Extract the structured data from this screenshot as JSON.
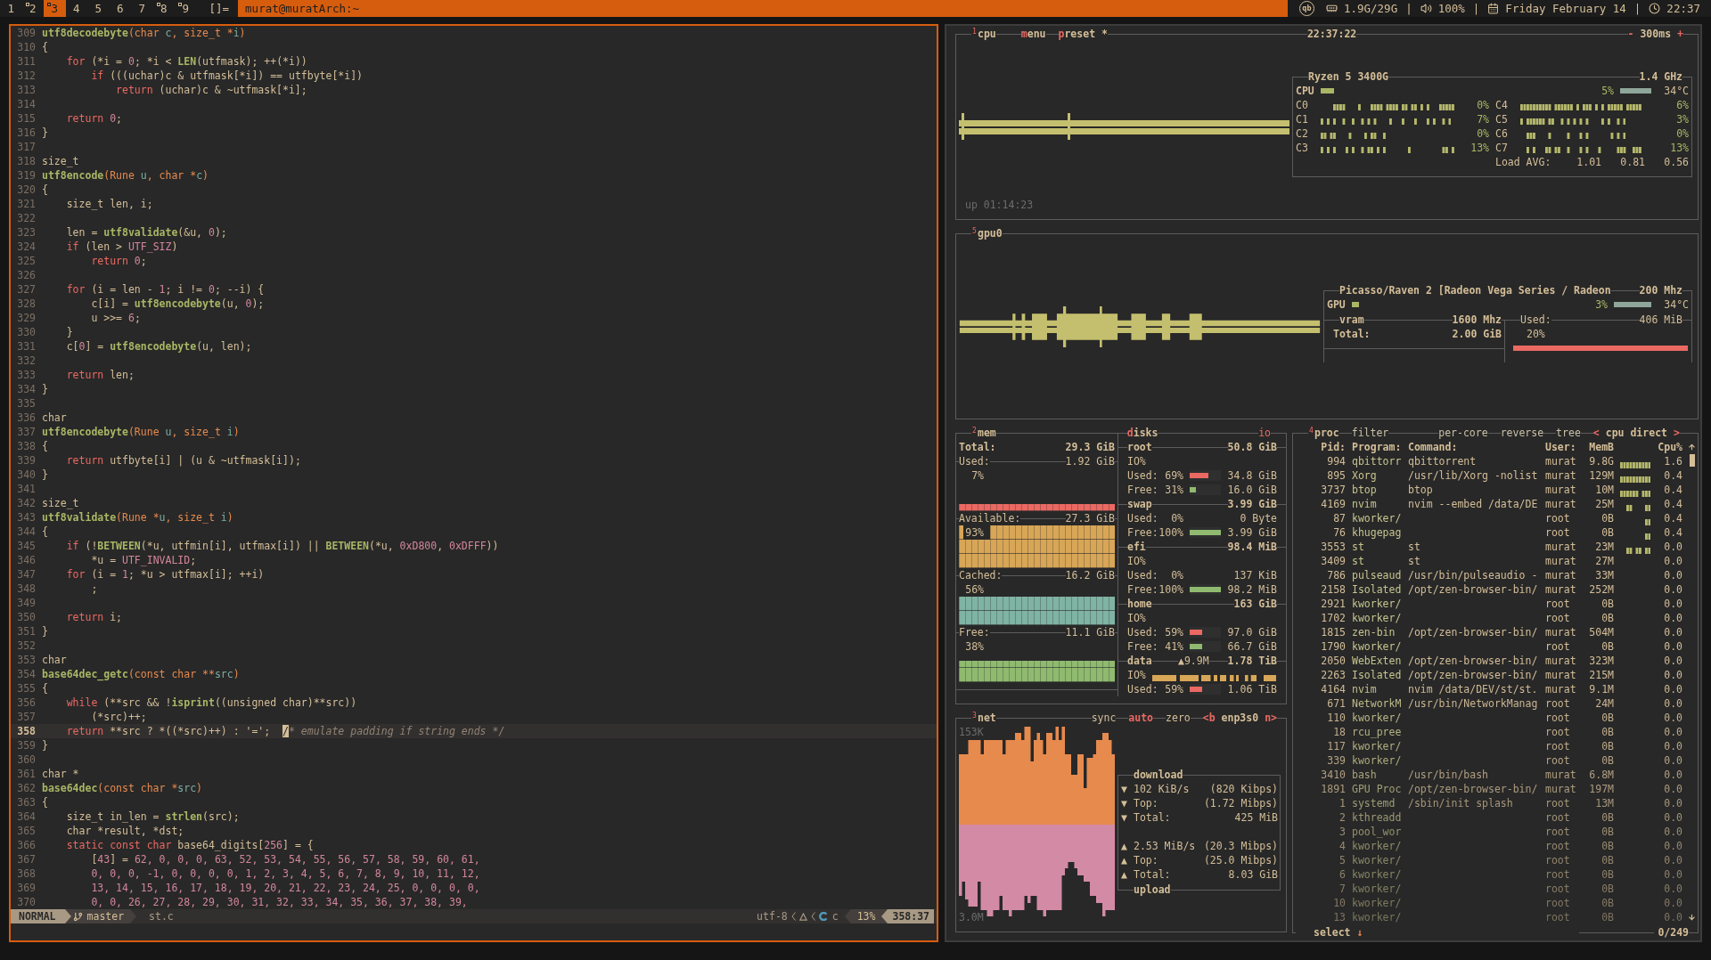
{
  "top_bar": {
    "tags": [
      {
        "label": "1",
        "occupied": false,
        "selected": false
      },
      {
        "label": "2",
        "occupied": true,
        "selected": false
      },
      {
        "label": "3",
        "occupied": true,
        "selected": true
      },
      {
        "label": "4",
        "occupied": false,
        "selected": false
      },
      {
        "label": "5",
        "occupied": false,
        "selected": false
      },
      {
        "label": "6",
        "occupied": false,
        "selected": false
      },
      {
        "label": "7",
        "occupied": false,
        "selected": false
      },
      {
        "label": "8",
        "occupied": true,
        "selected": false
      },
      {
        "label": "9",
        "occupied": true,
        "selected": false
      }
    ],
    "layout_symbol": "[]=",
    "window_title": "murat@muratArch:~",
    "tray_logo": "qb",
    "status": [
      {
        "kind": "memory",
        "text": "1.9G/29G"
      },
      {
        "kind": "volume",
        "separator": "|",
        "text": "100%"
      },
      {
        "kind": "date",
        "separator": "|",
        "text": "Friday February 14"
      },
      {
        "kind": "time",
        "separator": "|",
        "text": "22:37"
      }
    ]
  },
  "editor": {
    "lines": [
      {
        "number": "309",
        "current": false,
        "code": [
          {
            "text": "utf8decodebyte",
            "kind": "fn"
          },
          {
            "text": "(char ",
            "kind": "type"
          },
          {
            "text": "c",
            "kind": "param"
          },
          {
            "text": ", size_t *",
            "kind": "type"
          },
          {
            "text": "i",
            "kind": "param"
          },
          {
            "text": ")",
            "kind": "type"
          }
        ]
      },
      {
        "number": "310",
        "current": false,
        "code": [
          "{"
        ]
      },
      {
        "number": "311",
        "current": false,
        "code": [
          {
            "text": "    for",
            "kind": "kw"
          },
          " (*i = ",
          {
            "text": "0",
            "kind": "num"
          },
          "; *i < ",
          {
            "text": "LEN",
            "kind": "fn"
          },
          "(utfmask); ++(*i))"
        ]
      },
      {
        "number": "312",
        "current": false,
        "code": [
          {
            "text": "        if",
            "kind": "kw"
          },
          " (((uchar)c & utfmask[*i]) == utfbyte[*i])"
        ]
      },
      {
        "number": "313",
        "current": false,
        "code": [
          {
            "text": "            return",
            "kind": "kw"
          },
          " (uchar)c & ~utfmask[*i];"
        ]
      },
      {
        "number": "314",
        "current": false
      },
      {
        "number": "315",
        "current": false,
        "code": [
          {
            "text": "    return",
            "kind": "kw"
          },
          {
            "text": " 0",
            "kind": "num"
          },
          ";"
        ]
      },
      {
        "number": "316",
        "current": false,
        "code": [
          "}"
        ]
      },
      {
        "number": "317",
        "current": false
      },
      {
        "number": "318",
        "current": false,
        "code": [
          "size_t"
        ]
      },
      {
        "number": "319",
        "current": false,
        "code": [
          {
            "text": "utf8encode",
            "kind": "fn"
          },
          {
            "text": "(Rune ",
            "kind": "type"
          },
          {
            "text": "u",
            "kind": "param"
          },
          {
            "text": ", char *",
            "kind": "type"
          },
          {
            "text": "c",
            "kind": "param"
          },
          {
            "text": ")",
            "kind": "type"
          }
        ]
      },
      {
        "number": "320",
        "current": false,
        "code": [
          "{"
        ]
      },
      {
        "number": "321",
        "current": false,
        "code": [
          "    size_t len, i;"
        ]
      },
      {
        "number": "322",
        "current": false
      },
      {
        "number": "323",
        "current": false,
        "code": [
          "    len = ",
          {
            "text": "utf8validate",
            "kind": "fn"
          },
          "(&u, ",
          {
            "text": "0",
            "kind": "num"
          },
          ");"
        ]
      },
      {
        "number": "324",
        "current": false,
        "code": [
          {
            "text": "    if",
            "kind": "kw"
          },
          " (len > ",
          {
            "text": "UTF_SIZ",
            "kind": "num"
          },
          ")"
        ]
      },
      {
        "number": "325",
        "current": false,
        "code": [
          {
            "text": "        return",
            "kind": "kw"
          },
          {
            "text": " 0",
            "kind": "num"
          },
          ";"
        ]
      },
      {
        "number": "326",
        "current": false
      },
      {
        "number": "327",
        "current": false,
        "code": [
          {
            "text": "    for",
            "kind": "kw"
          },
          " (i = len - ",
          {
            "text": "1",
            "kind": "num"
          },
          "; i != ",
          {
            "text": "0",
            "kind": "num"
          },
          "; --i) {"
        ]
      },
      {
        "number": "328",
        "current": false,
        "code": [
          "        c[i] = ",
          {
            "text": "utf8encodebyte",
            "kind": "fn"
          },
          "(u, ",
          {
            "text": "0",
            "kind": "num"
          },
          ");"
        ]
      },
      {
        "number": "329",
        "current": false,
        "code": [
          "        u >>= ",
          {
            "text": "6",
            "kind": "num"
          },
          ";"
        ]
      },
      {
        "number": "330",
        "current": false,
        "code": [
          "    }"
        ]
      },
      {
        "number": "331",
        "current": false,
        "code": [
          "    c[",
          {
            "text": "0",
            "kind": "num"
          },
          "] = ",
          {
            "text": "utf8encodebyte",
            "kind": "fn"
          },
          "(u, len);"
        ]
      },
      {
        "number": "332",
        "current": false
      },
      {
        "number": "333",
        "current": false,
        "code": [
          {
            "text": "    return",
            "kind": "kw"
          },
          " len;"
        ]
      },
      {
        "number": "334",
        "current": false,
        "code": [
          "}"
        ]
      },
      {
        "number": "335",
        "current": false
      },
      {
        "number": "336",
        "current": false,
        "code": [
          "char"
        ]
      },
      {
        "number": "337",
        "current": false,
        "code": [
          {
            "text": "utf8encodebyte",
            "kind": "fn"
          },
          {
            "text": "(Rune ",
            "kind": "type"
          },
          {
            "text": "u",
            "kind": "param"
          },
          {
            "text": ", size_t ",
            "kind": "type"
          },
          {
            "text": "i",
            "kind": "param"
          },
          {
            "text": ")",
            "kind": "type"
          }
        ]
      },
      {
        "number": "338",
        "current": false,
        "code": [
          "{"
        ]
      },
      {
        "number": "339",
        "current": false,
        "code": [
          {
            "text": "    return",
            "kind": "kw"
          },
          " utfbyte[i] | (u & ~utfmask[i]);"
        ]
      },
      {
        "number": "340",
        "current": false,
        "code": [
          "}"
        ]
      },
      {
        "number": "341",
        "current": false
      },
      {
        "number": "342",
        "current": false,
        "code": [
          "size_t"
        ]
      },
      {
        "number": "343",
        "current": false,
        "code": [
          {
            "text": "utf8validate",
            "kind": "fn"
          },
          {
            "text": "(Rune *",
            "kind": "type"
          },
          {
            "text": "u",
            "kind": "param"
          },
          {
            "text": ", size_t ",
            "kind": "type"
          },
          {
            "text": "i",
            "kind": "param"
          },
          {
            "text": ")",
            "kind": "type"
          }
        ]
      },
      {
        "number": "344",
        "current": false,
        "code": [
          "{"
        ]
      },
      {
        "number": "345",
        "current": false,
        "code": [
          {
            "text": "    if",
            "kind": "kw"
          },
          " (!",
          {
            "text": "BETWEEN",
            "kind": "fn"
          },
          "(*u, utfmin[i], utfmax[i]) || ",
          {
            "text": "BETWEEN",
            "kind": "fn"
          },
          "(*u, ",
          {
            "text": "0xD800",
            "kind": "num"
          },
          ", ",
          {
            "text": "0xDFFF",
            "kind": "num"
          },
          "))"
        ]
      },
      {
        "number": "346",
        "current": false,
        "code": [
          "        *u = ",
          {
            "text": "UTF_INVALID",
            "kind": "num"
          },
          ";"
        ]
      },
      {
        "number": "347",
        "current": false,
        "code": [
          {
            "text": "    for",
            "kind": "kw"
          },
          " (i = ",
          {
            "text": "1",
            "kind": "num"
          },
          "; *u > utfmax[i]; ++i)"
        ]
      },
      {
        "number": "348",
        "current": false,
        "code": [
          "        ;"
        ]
      },
      {
        "number": "349",
        "current": false
      },
      {
        "number": "350",
        "current": false,
        "code": [
          {
            "text": "    return",
            "kind": "kw"
          },
          " i;"
        ]
      },
      {
        "number": "351",
        "current": false,
        "code": [
          "}"
        ]
      },
      {
        "number": "352",
        "current": false
      },
      {
        "number": "353",
        "current": false,
        "code": [
          "char"
        ]
      },
      {
        "number": "354",
        "current": false,
        "code": [
          {
            "text": "base64dec_getc",
            "kind": "fn"
          },
          {
            "text": "(const char **",
            "kind": "type"
          },
          {
            "text": "src",
            "kind": "param"
          },
          {
            "text": ")",
            "kind": "type"
          }
        ]
      },
      {
        "number": "355",
        "current": false,
        "code": [
          "{"
        ]
      },
      {
        "number": "356",
        "current": false,
        "code": [
          {
            "text": "    while",
            "kind": "kw"
          },
          " (**src && !",
          {
            "text": "isprint",
            "kind": "fn"
          },
          "((unsigned char)**src))"
        ]
      },
      {
        "number": "357",
        "current": false,
        "code": [
          "        (*src)++;"
        ]
      },
      {
        "number": "358",
        "current": true,
        "code": [
          {
            "text": "    return",
            "kind": "kw"
          },
          " **src ? *((*src)++) : '=';  ",
          {
            "text": "/* emulate padding if string ends */",
            "kind": "comment",
            "cursor": true
          }
        ]
      },
      {
        "number": "359",
        "current": false,
        "code": [
          "}"
        ]
      },
      {
        "number": "360",
        "current": false
      },
      {
        "number": "361",
        "current": false,
        "code": [
          "char *"
        ]
      },
      {
        "number": "362",
        "current": false,
        "code": [
          {
            "text": "base64dec",
            "kind": "fn"
          },
          {
            "text": "(const char *",
            "kind": "type"
          },
          {
            "text": "src",
            "kind": "param"
          },
          {
            "text": ")",
            "kind": "type"
          }
        ]
      },
      {
        "number": "363",
        "current": false,
        "code": [
          "{"
        ]
      },
      {
        "number": "364",
        "current": false,
        "code": [
          "    size_t in_len = ",
          {
            "text": "strlen",
            "kind": "fn"
          },
          "(src);"
        ]
      },
      {
        "number": "365",
        "current": false,
        "code": [
          "    char *result, *dst;"
        ]
      },
      {
        "number": "366",
        "current": false,
        "code": [
          {
            "text": "    static const char",
            "kind": "kw"
          },
          " base64_digits[",
          {
            "text": "256",
            "kind": "num"
          },
          "] = {"
        ]
      },
      {
        "number": "367",
        "current": false,
        "code": [
          "        [",
          {
            "text": "43",
            "kind": "num"
          },
          "] = ",
          {
            "text": "62, 0, 0, 0, 63, 52, 53, 54, 55, 56, 57, 58, 59, 60, 61,",
            "kind": "num"
          }
        ]
      },
      {
        "number": "368",
        "current": false,
        "code": [
          {
            "text": "        0, 0, 0, -1, 0, 0, 0, 0, 1, 2, 3, 4, 5, 6, 7, 8, 9, 10, 11, 12,",
            "kind": "num"
          }
        ]
      },
      {
        "number": "369",
        "current": false,
        "code": [
          {
            "text": "        13, 14, 15, 16, 17, 18, 19, 20, 21, 22, 23, 24, 25, 0, 0, 0, 0,",
            "kind": "num"
          }
        ]
      },
      {
        "number": "370",
        "current": false,
        "code": [
          {
            "text": "        0, 0, 26, 27, 28, 29, 30, 31, 32, 33, 34, 35, 36, 37, 38, 39,",
            "kind": "num"
          }
        ]
      }
    ],
    "statusline": {
      "mode": "NORMAL",
      "branch": "master",
      "file": "st.c",
      "encoding": "utf-8",
      "filetype": "c",
      "progress": "13%",
      "position": "358:37"
    }
  },
  "monitor": {
    "cpu": {
      "hotkey": "1",
      "title": "cpu",
      "menu": "menu",
      "preset": "preset *",
      "clock": "22:37:22",
      "interval": {
        "decrease": "-",
        "value": "300ms",
        "increase": "+"
      },
      "uptime": "up 01:14:23",
      "model": "Ryzen 5 3400G",
      "frequency": "1.4 GHz",
      "total": {
        "label": "CPU",
        "level": 0.05,
        "percent": "5%",
        "temperature": "34°C"
      },
      "cores": [
        {
          "label": "C0",
          "percent": "0%"
        },
        {
          "label": "C1",
          "percent": "7%"
        },
        {
          "label": "C2",
          "percent": "0%"
        },
        {
          "label": "C3",
          "percent": "13%"
        },
        {
          "label": "C4",
          "percent": "6%"
        },
        {
          "label": "C5",
          "percent": "3%"
        },
        {
          "label": "C6",
          "percent": "0%"
        },
        {
          "label": "C7",
          "percent": "13%"
        }
      ],
      "load": {
        "label": "Load AVG:",
        "values": [
          "1.01",
          "0.81",
          "0.56"
        ]
      }
    },
    "gpu": {
      "hotkey": "5",
      "title": "gpu0",
      "model": "Picasso/Raven 2 [Radeon Vega Series / Radeon",
      "frequency": "200 Mhz",
      "usage": {
        "label": "GPU",
        "level": 0.03,
        "percent": "3%",
        "temperature": "34°C"
      },
      "vram": {
        "title": "vram",
        "clock": "1600 Mhz",
        "total_label": "Total:",
        "total": "2.00 GiB",
        "used_label": "Used:",
        "used": "406 MiB",
        "percent": "20%"
      }
    },
    "memory": {
      "hotkey": "2",
      "title": "mem",
      "total_label": "Total:",
      "total": "29.3 GiB",
      "stats": [
        {
          "label": "Used:",
          "value": "1.92 GiB",
          "percent": "7%",
          "color": "#ea6962"
        },
        {
          "label": "Available:",
          "value": "27.3 GiB",
          "percent": "93%",
          "color": "#d8a657"
        },
        {
          "label": "Cached:",
          "value": "16.2 GiB",
          "percent": "56%",
          "color": "#7fb3a3"
        },
        {
          "label": "Free:",
          "value": "11.1 GiB",
          "percent": "38%",
          "color": "#8fba6f"
        }
      ]
    },
    "disks": {
      "title": "disks",
      "io_toggle": "io",
      "items": [
        {
          "name": "root",
          "size": "50.8 GiB",
          "io_label": "IO%",
          "rows": [
            {
              "kind": "used",
              "label": "Used:",
              "percent": "69%",
              "level": 0.6,
              "value": "34.8 GiB"
            },
            {
              "kind": "free",
              "label": "Free:",
              "percent": "31%",
              "level": 0.2,
              "value": "16.0 GiB"
            }
          ]
        },
        {
          "name": "swap",
          "size": "3.99 GiB",
          "rows": [
            {
              "label": "Used:",
              "percent": "0%",
              "value": "0 Byte"
            },
            {
              "kind": "free",
              "label": "Free:",
              "percent": "100%",
              "level": 1,
              "value": "3.99 GiB"
            }
          ]
        },
        {
          "name": "efi",
          "size": "98.4 MiB",
          "io_label": "IO%",
          "rows": [
            {
              "label": "Used:",
              "percent": "0%",
              "value": "137 KiB"
            },
            {
              "kind": "free",
              "label": "Free:",
              "percent": "100%",
              "level": 1,
              "value": "98.2 MiB"
            }
          ]
        },
        {
          "name": "home",
          "size": "163 GiB",
          "io_label": "IO%",
          "rows": [
            {
              "kind": "used",
              "label": "Used:",
              "percent": "59%",
              "level": 0.4,
              "value": "97.0 GiB"
            },
            {
              "kind": "free",
              "label": "Free:",
              "percent": "41%",
              "level": 0.4,
              "value": "66.7 GiB"
            }
          ]
        },
        {
          "name": "data",
          "rate": "▲9.9M",
          "size": "1.78 TiB",
          "io_label": "IO%",
          "io_graph": true,
          "rows": [
            {
              "kind": "used",
              "label": "Used:",
              "percent": "59%",
              "level": 0.4,
              "value": "1.06 TiB"
            }
          ]
        }
      ]
    },
    "network": {
      "hotkey": "3",
      "title": "net",
      "options": [
        {
          "label": "sync",
          "on": false
        },
        {
          "label": "auto",
          "on": true
        },
        {
          "label": "zero",
          "on": false
        }
      ],
      "interface": {
        "previous": "<b",
        "name": "enp3s0",
        "next": "n>"
      },
      "scale_top": "153K",
      "scale_bottom": "3.0M",
      "download_title": "download",
      "upload_title": "upload",
      "download_stats": [
        {
          "arrow": "▼",
          "label": "102 KiB/s",
          "value": "(820 Kibps)"
        },
        {
          "arrow": "▼",
          "label": "Top:",
          "value": "(1.72 Mibps)"
        },
        {
          "arrow": "▼",
          "label": "Total:",
          "value": "425 MiB"
        }
      ],
      "upload_stats": [
        {
          "arrow": "▲",
          "label": "2.53 MiB/s",
          "value": "(20.3 Mibps)"
        },
        {
          "arrow": "▲",
          "label": "Top:",
          "value": "(25.0 Mibps)"
        },
        {
          "arrow": "▲",
          "label": "Total:",
          "value": "8.03 GiB"
        }
      ]
    },
    "processes": {
      "hotkey": "4",
      "title": "proc",
      "options": [
        "filter",
        "per-core",
        "reverse",
        "tree"
      ],
      "sort": {
        "previous": "<",
        "name": "cpu direct",
        "next": ">"
      },
      "columns": [
        "Pid:",
        "Program:",
        "Command:",
        "User:",
        "MemB",
        "Cpu%"
      ],
      "rows": [
        {
          "pid": "994",
          "program": "qbittorr",
          "command": "qbittorrent",
          "user": "murat",
          "memory": "9.8G",
          "cpu": "1.6"
        },
        {
          "pid": "895",
          "program": "Xorg",
          "command": "/usr/lib/Xorg -nolist",
          "user": "murat",
          "memory": "129M",
          "cpu": "0.4"
        },
        {
          "pid": "3737",
          "program": "btop",
          "command": "btop",
          "user": "murat",
          "memory": "10M",
          "cpu": "0.4"
        },
        {
          "pid": "4169",
          "program": "nvim",
          "command": "nvim --embed /data/DE",
          "user": "murat",
          "memory": "25M",
          "cpu": "0.4"
        },
        {
          "pid": "87",
          "program": "kworker/",
          "user": "root",
          "memory": "0B",
          "cpu": "0.4"
        },
        {
          "pid": "76",
          "program": "khugepag",
          "user": "root",
          "memory": "0B",
          "cpu": "0.4"
        },
        {
          "pid": "3553",
          "program": "st",
          "command": "st",
          "user": "murat",
          "memory": "23M",
          "cpu": "0.0"
        },
        {
          "pid": "3409",
          "program": "st",
          "command": "st",
          "user": "murat",
          "memory": "27M",
          "cpu": "0.0"
        },
        {
          "pid": "786",
          "program": "pulseaud",
          "command": "/usr/bin/pulseaudio -",
          "user": "murat",
          "memory": "33M",
          "cpu": "0.0"
        },
        {
          "pid": "2158",
          "program": "Isolated",
          "command": "/opt/zen-browser-bin/",
          "user": "murat",
          "memory": "252M",
          "cpu": "0.0"
        },
        {
          "pid": "2921",
          "program": "kworker/",
          "user": "root",
          "memory": "0B",
          "cpu": "0.0"
        },
        {
          "pid": "1702",
          "program": "kworker/",
          "user": "root",
          "memory": "0B",
          "cpu": "0.0"
        },
        {
          "pid": "1815",
          "program": "zen-bin",
          "command": "/opt/zen-browser-bin/",
          "user": "murat",
          "memory": "504M",
          "cpu": "0.0"
        },
        {
          "pid": "1790",
          "program": "kworker/",
          "user": "root",
          "memory": "0B",
          "cpu": "0.0"
        },
        {
          "pid": "2050",
          "program": "WebExten",
          "command": "/opt/zen-browser-bin/",
          "user": "murat",
          "memory": "323M",
          "cpu": "0.0"
        },
        {
          "pid": "2263",
          "program": "Isolated",
          "command": "/opt/zen-browser-bin/",
          "user": "murat",
          "memory": "215M",
          "cpu": "0.0"
        },
        {
          "pid": "4164",
          "program": "nvim",
          "command": "nvim /data/DEV/st/st.",
          "user": "murat",
          "memory": "9.1M",
          "cpu": "0.0"
        },
        {
          "pid": "671",
          "program": "NetworkM",
          "command": "/usr/bin/NetworkManag",
          "user": "root",
          "memory": "24M",
          "cpu": "0.0"
        },
        {
          "pid": "110",
          "program": "kworker/",
          "user": "root",
          "memory": "0B",
          "cpu": "0.0"
        },
        {
          "pid": "18",
          "program": "rcu_pree",
          "user": "root",
          "memory": "0B",
          "cpu": "0.0"
        },
        {
          "pid": "117",
          "program": "kworker/",
          "user": "root",
          "memory": "0B",
          "cpu": "0.0"
        },
        {
          "pid": "339",
          "program": "kworker/",
          "user": "root",
          "memory": "0B",
          "cpu": "0.0"
        },
        {
          "pid": "3410",
          "program": "bash",
          "command": "/usr/bin/bash",
          "user": "murat",
          "memory": "6.8M",
          "cpu": "0.0"
        },
        {
          "pid": "1891",
          "program": "GPU Proc",
          "command": "/opt/zen-browser-bin/",
          "user": "murat",
          "memory": "197M",
          "cpu": "0.0"
        },
        {
          "pid": "1",
          "program": "systemd",
          "command": "/sbin/init splash",
          "user": "root",
          "memory": "13M",
          "cpu": "0.0"
        },
        {
          "pid": "2",
          "program": "kthreadd",
          "user": "root",
          "memory": "0B",
          "cpu": "0.0"
        },
        {
          "pid": "3",
          "program": "pool_wor",
          "user": "root",
          "memory": "0B",
          "cpu": "0.0"
        },
        {
          "pid": "4",
          "program": "kworker/",
          "user": "root",
          "memory": "0B",
          "cpu": "0.0"
        },
        {
          "pid": "5",
          "program": "kworker/",
          "user": "root",
          "memory": "0B",
          "cpu": "0.0"
        },
        {
          "pid": "6",
          "program": "kworker/",
          "user": "root",
          "memory": "0B",
          "cpu": "0.0"
        },
        {
          "pid": "7",
          "program": "kworker/",
          "user": "root",
          "memory": "0B",
          "cpu": "0.0"
        },
        {
          "pid": "10",
          "program": "kworker/",
          "user": "root",
          "memory": "0B",
          "cpu": "0.0"
        },
        {
          "pid": "13",
          "program": "kworker/",
          "user": "root",
          "memory": "0B",
          "cpu": "0.0"
        }
      ],
      "select": {
        "label": "select",
        "key": "↓"
      },
      "count": "0/249"
    }
  }
}
